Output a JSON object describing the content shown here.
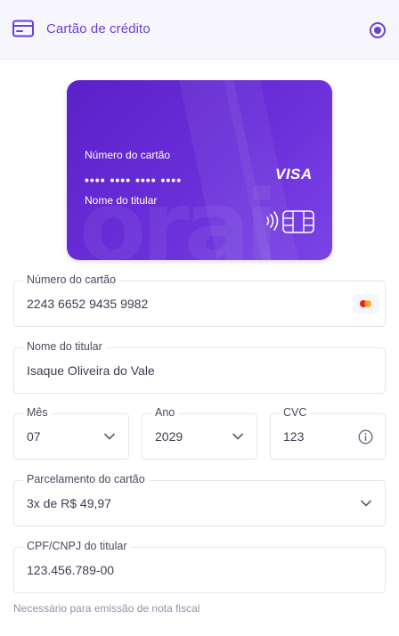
{
  "header": {
    "title": "Cartão de crédito",
    "icon": "credit-card-icon",
    "selected": true,
    "accent_color": "#6a3fd8"
  },
  "card_preview": {
    "number_label": "Número do cartão",
    "number_masked": "•••• •••• •••• ••••",
    "holder_label": "Nome do titular",
    "brand": "VISA",
    "card_color": "#6a2fd9"
  },
  "form": {
    "card_number": {
      "label": "Número do cartão",
      "value": "2243 6652 9435 9982",
      "brand_icon": "mastercard-icon"
    },
    "holder_name": {
      "label": "Nome do titular",
      "value": "Isaque Oliveira do Vale"
    },
    "month": {
      "label": "Mês",
      "value": "07"
    },
    "year": {
      "label": "Ano",
      "value": "2029"
    },
    "cvc": {
      "label": "CVC",
      "value": "123"
    },
    "installments": {
      "label": "Parcelamento do cartão",
      "value": "3x de R$ 49,97"
    },
    "document": {
      "label": "CPF/CNPJ do titular",
      "value": "123.456.789-00",
      "hint": "Necessário para emissão de nota fiscal"
    }
  }
}
